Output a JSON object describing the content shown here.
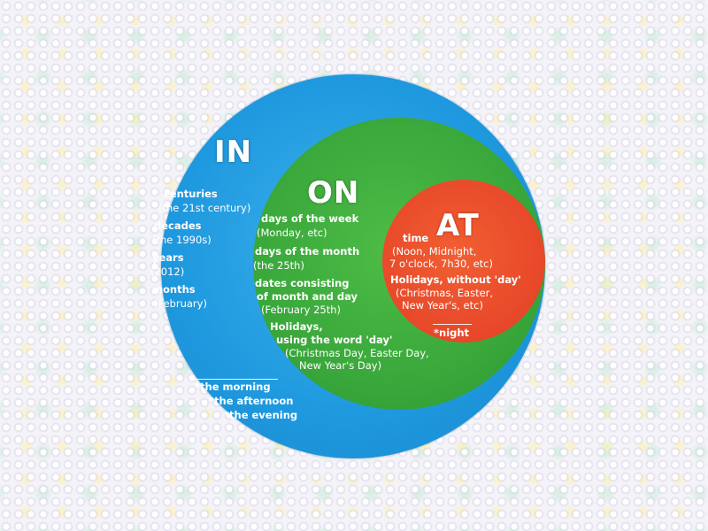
{
  "in": {
    "title": "IN",
    "items": [
      {
        "label": "centuries",
        "detail": "(the 21st century)"
      },
      {
        "label": "decades",
        "detail": "(the 1990s)"
      },
      {
        "label": "years",
        "detail": "(2012)"
      },
      {
        "label": "months",
        "detail": "(February)"
      }
    ],
    "notes": [
      "*the morning",
      "*the afternoon",
      "*the evening"
    ]
  },
  "on": {
    "title": "ON",
    "items": [
      {
        "label": "days of the week",
        "detail": "(Monday, etc)"
      },
      {
        "label": "days of the month",
        "detail": "(the 25th)"
      },
      {
        "label": "dates consisting",
        "label2": "of month and day",
        "detail": "(February 25th)"
      },
      {
        "label": "Holidays,",
        "label2": "using the word 'day'",
        "detail": "(Christmas Day, Easter Day,",
        "detail2": "New Year's Day)"
      }
    ]
  },
  "at": {
    "title": "AT",
    "items": [
      {
        "label": "time",
        "detail": "(Noon, Midnight,",
        "detail2": "7 o'clock, 7h30, etc)"
      },
      {
        "label": "Holidays, without 'day'",
        "detail": "(Christmas, Easter,",
        "detail2": "New Year's, etc)"
      }
    ],
    "notes": [
      "*night"
    ]
  },
  "colors": {
    "in_circle": "#1e98de",
    "on_circle": "#38a63a",
    "at_circle": "#e8492a",
    "text": "#ffffff"
  }
}
